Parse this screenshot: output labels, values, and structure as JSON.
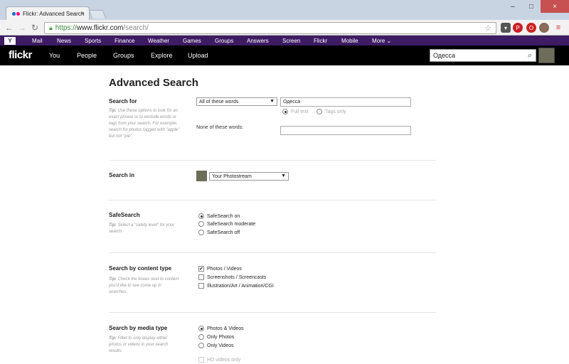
{
  "browser": {
    "tab_title": "Flickr: Advanced Search",
    "tab_close": "×",
    "url_https": "https://",
    "url_host": "www.flickr.com",
    "url_path": "/search/",
    "win_min": "–",
    "win_max": "□",
    "win_close": "×"
  },
  "yahoo_bar": {
    "logo": "Y",
    "links": [
      "Mail",
      "News",
      "Sports",
      "Finance",
      "Weather",
      "Games",
      "Groups",
      "Answers",
      "Screen",
      "Flickr",
      "Mobile",
      "More ⌄"
    ]
  },
  "flickr_nav": {
    "logo": "flickr",
    "items": [
      "You",
      "People",
      "Groups",
      "Explore",
      "Upload"
    ],
    "search_value": "Одесса"
  },
  "page": {
    "title": "Advanced Search",
    "search_for": {
      "title": "Search for",
      "tip_label": "Tip:",
      "tip": " Use these options to look for an exact phrase or to exclude words or tags from your search. For example, search for photos tagged with \"apple\" but not \"pie\".",
      "mode_select": "All of these words",
      "query_value": "Одесса",
      "radio_fulltext": "Full text",
      "radio_tags": "Tags only",
      "none_label": "None of these words:",
      "none_value": ""
    },
    "search_in": {
      "title": "Search in",
      "select": "Your Photostream"
    },
    "safesearch": {
      "title": "SafeSearch",
      "tip_label": "Tip:",
      "tip": " Select a \"safety level\" for your search.",
      "options": [
        "SafeSearch on",
        "SafeSearch moderate",
        "SafeSearch off"
      ],
      "selected": 0
    },
    "content_type": {
      "title": "Search by content type",
      "tip_label": "Tip:",
      "tip": " Check the boxes next to content you'd like to see come up in searches.",
      "options": [
        "Photos / Videos",
        "Screenshots / Screencasts",
        "Illustration/Art / Animation/CGI"
      ]
    },
    "media_type": {
      "title": "Search by media type",
      "tip_label": "Tip:",
      "tip": " Filter to only display either photos or videos in your search results.",
      "options": [
        "Photos & Videos",
        "Only Photos",
        "Only Videos"
      ],
      "hd_option": "HD videos only"
    }
  }
}
